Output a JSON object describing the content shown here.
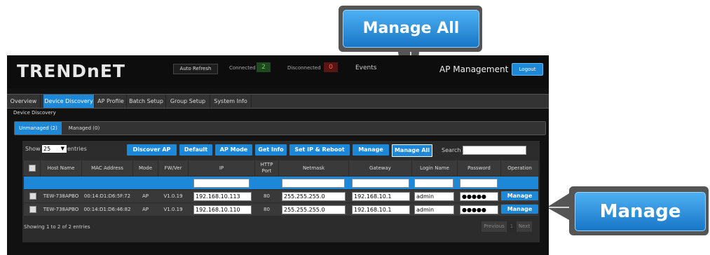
{
  "header": {
    "logo": "TRENDnET",
    "auto_refresh": "Auto Refresh",
    "connected_label": "Connected",
    "connected_count": "2",
    "disconnected_label": "Disconnected",
    "disconnected_count": "0",
    "events": "Events",
    "title": "AP Management",
    "logout": "Logout"
  },
  "tabs": [
    "Overview",
    "Device Discovery",
    "AP Profile",
    "Batch Setup",
    "Group Setup",
    "System Info"
  ],
  "section_title": "Device Discovery",
  "subtabs": [
    "Unmanaged (2)",
    "Managed (0)"
  ],
  "table_controls": {
    "show": "Show",
    "page_size": "25",
    "entries": "entries",
    "search": "Search"
  },
  "actions": [
    "Discover AP",
    "Default",
    "AP Mode",
    "Get Info",
    "Set IP & Reboot",
    "Manage",
    "Manage All"
  ],
  "columns": [
    "Host Name",
    "MAC Address",
    "Mode",
    "FW/Ver",
    "IP",
    "HTTP Port",
    "Netmask",
    "Gateway",
    "Login Name",
    "Password",
    "Operation"
  ],
  "rows": [
    {
      "host": "TEW-738APBO",
      "mac": "00:14:D1:D6:5F:72",
      "mode": "AP",
      "fw": "V1.0.19",
      "ip": "192.168.10.113",
      "port": "80",
      "netmask": "255.255.255.0",
      "gateway": "192.168.10.1",
      "login": "admin",
      "password": "●●●●●",
      "operation": "Manage"
    },
    {
      "host": "TEW-738APBO",
      "mac": "00:14:D1:D6:46:82",
      "mode": "AP",
      "fw": "V1.0.19",
      "ip": "192.168.10.110",
      "port": "80",
      "netmask": "255.255.255.0",
      "gateway": "192.168.10.1",
      "login": "admin",
      "password": "●●●●●",
      "operation": "Manage"
    }
  ],
  "footer": {
    "info": "Showing 1 to 2 of 2 entries",
    "previous": "Previous",
    "page": "1",
    "next": "Next"
  },
  "callouts": {
    "manage_all": "Manage All",
    "manage": "Manage"
  },
  "colors": {
    "accent": "#1e88d8",
    "connected": "#2e9e2e",
    "disconnected": "#d9261c"
  }
}
